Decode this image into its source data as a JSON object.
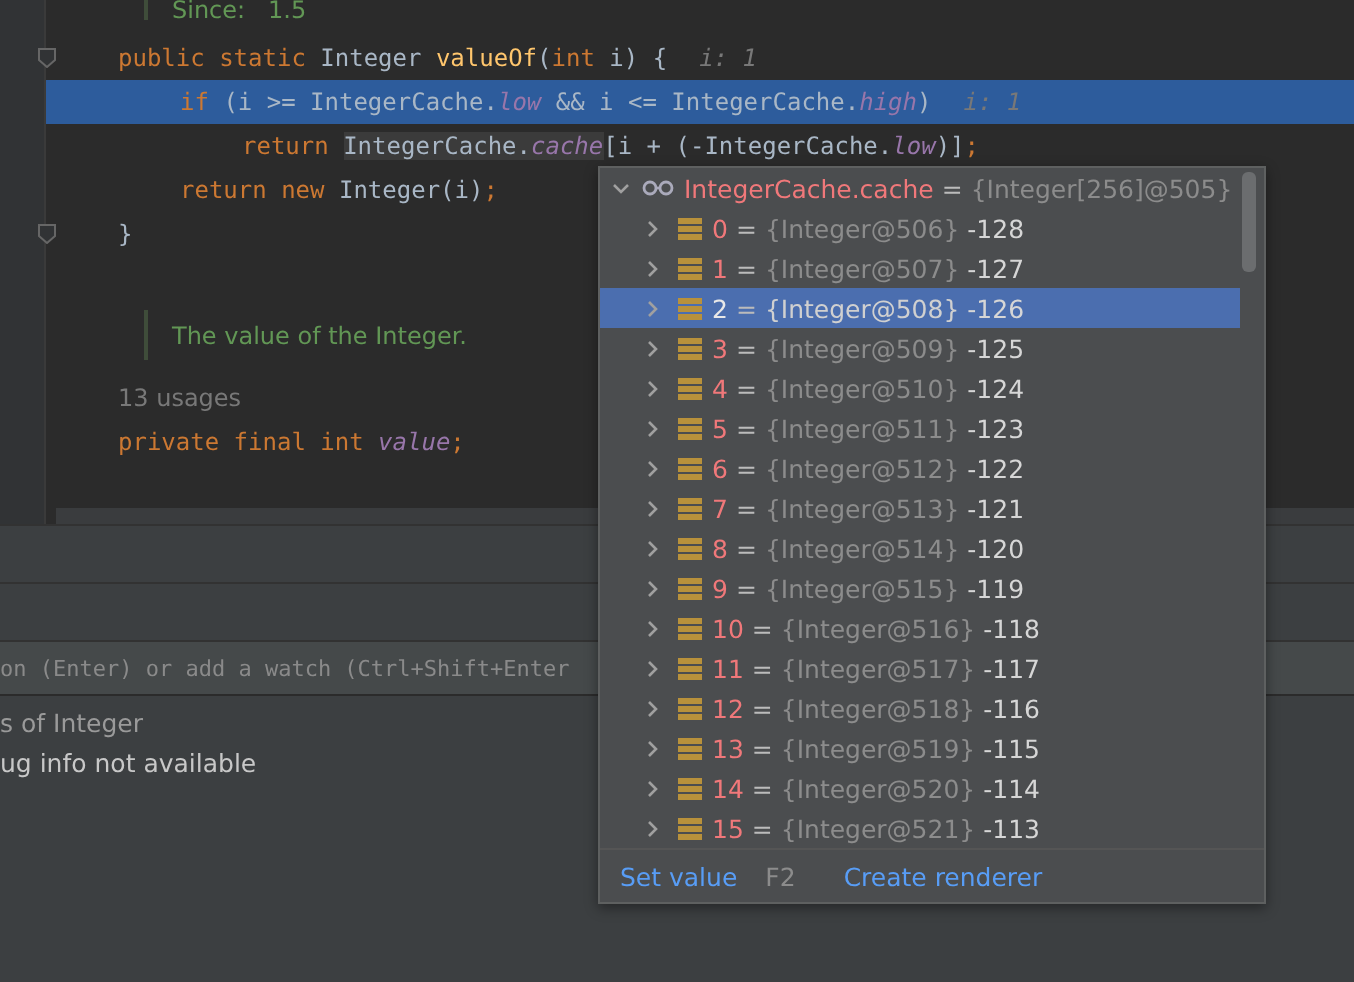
{
  "editor": {
    "lines": [
      {
        "kind": "doc",
        "fold": false,
        "highlighted": false,
        "tokens": [
          {
            "kind": "doc",
            "text": "Since:   1.5"
          }
        ]
      },
      {
        "kind": "code",
        "fold": true,
        "highlighted": false,
        "tokens": [
          {
            "kind": "kw",
            "text": "public static "
          },
          {
            "kind": "plain",
            "text": "Integer "
          },
          {
            "kind": "method",
            "text": "valueOf"
          },
          {
            "kind": "plain",
            "text": "("
          },
          {
            "kind": "kw",
            "text": "int "
          },
          {
            "kind": "plain",
            "text": "i) {"
          },
          {
            "kind": "hint",
            "text": "i: 1"
          }
        ],
        "children": [
          {
            "kind": "code",
            "fold": false,
            "highlighted": true,
            "tokens": [
              {
                "kind": "kw",
                "text": "if "
              },
              {
                "kind": "plain",
                "text": "(i >= IntegerCache."
              },
              {
                "kind": "field",
                "text": "low"
              },
              {
                "kind": "plain",
                "text": " && i <= IntegerCache."
              },
              {
                "kind": "field",
                "text": "high"
              },
              {
                "kind": "plain",
                "text": ")"
              },
              {
                "kind": "hint",
                "text": "i: 1"
              }
            ],
            "children": [
              {
                "kind": "code",
                "fold": false,
                "highlighted": false,
                "tokens": [
                  {
                    "kind": "kw",
                    "text": "return "
                  },
                  {
                    "kind": "ref",
                    "text": "IntegerCache."
                  },
                  {
                    "kind": "reffield",
                    "text": "cache"
                  },
                  {
                    "kind": "plain",
                    "text": "[i + (-IntegerCache."
                  },
                  {
                    "kind": "field",
                    "text": "low"
                  },
                  {
                    "kind": "plain",
                    "text": ")]"
                  },
                  {
                    "kind": "kw",
                    "text": ";"
                  }
                ]
              }
            ]
          },
          {
            "kind": "code",
            "fold": false,
            "highlighted": false,
            "tokens": [
              {
                "kind": "kw",
                "text": "return new "
              },
              {
                "kind": "plain",
                "text": "Integer(i)"
              },
              {
                "kind": "kw",
                "text": ";"
              }
            ]
          }
        ]
      },
      {
        "kind": "code",
        "fold": true,
        "highlighted": false,
        "tokens": [
          {
            "kind": "plain",
            "text": "}"
          }
        ]
      },
      {
        "kind": "doc",
        "fold": false,
        "highlighted": false,
        "tokens": [
          {
            "kind": "doc",
            "text": "The value of the Integer."
          }
        ]
      },
      {
        "kind": "usages",
        "fold": false,
        "highlighted": false,
        "tokens": [
          {
            "kind": "usages",
            "text": "13 usages"
          }
        ]
      },
      {
        "kind": "code",
        "fold": false,
        "highlighted": false,
        "tokens": [
          {
            "kind": "kw",
            "text": "private final int "
          },
          {
            "kind": "field",
            "text": "value"
          },
          {
            "kind": "kw",
            "text": ";"
          }
        ]
      }
    ]
  },
  "debugger": {
    "watch": {
      "placeholder": "on (Enter) or add a watch (Ctrl+Shift+Enter"
    },
    "variables": [
      {
        "text": "s of Integer",
        "dim": true
      },
      {
        "text": "ug info not available",
        "dim": false
      }
    ]
  },
  "popup": {
    "header": {
      "name": "IntegerCache.cache",
      "eq": "=",
      "ref": "{Integer[256]@505}",
      "expanded": true
    },
    "items": [
      {
        "name": "0",
        "eq": "=",
        "ref": "{Integer@506}",
        "value": "-128",
        "selected": false
      },
      {
        "name": "1",
        "eq": "=",
        "ref": "{Integer@507}",
        "value": "-127",
        "selected": false
      },
      {
        "name": "2",
        "eq": "=",
        "ref": "{Integer@508}",
        "value": "-126",
        "selected": true
      },
      {
        "name": "3",
        "eq": "=",
        "ref": "{Integer@509}",
        "value": "-125",
        "selected": false
      },
      {
        "name": "4",
        "eq": "=",
        "ref": "{Integer@510}",
        "value": "-124",
        "selected": false
      },
      {
        "name": "5",
        "eq": "=",
        "ref": "{Integer@511}",
        "value": "-123",
        "selected": false
      },
      {
        "name": "6",
        "eq": "=",
        "ref": "{Integer@512}",
        "value": "-122",
        "selected": false
      },
      {
        "name": "7",
        "eq": "=",
        "ref": "{Integer@513}",
        "value": "-121",
        "selected": false
      },
      {
        "name": "8",
        "eq": "=",
        "ref": "{Integer@514}",
        "value": "-120",
        "selected": false
      },
      {
        "name": "9",
        "eq": "=",
        "ref": "{Integer@515}",
        "value": "-119",
        "selected": false
      },
      {
        "name": "10",
        "eq": "=",
        "ref": "{Integer@516}",
        "value": "-118",
        "selected": false
      },
      {
        "name": "11",
        "eq": "=",
        "ref": "{Integer@517}",
        "value": "-117",
        "selected": false
      },
      {
        "name": "12",
        "eq": "=",
        "ref": "{Integer@518}",
        "value": "-116",
        "selected": false
      },
      {
        "name": "13",
        "eq": "=",
        "ref": "{Integer@519}",
        "value": "-115",
        "selected": false
      },
      {
        "name": "14",
        "eq": "=",
        "ref": "{Integer@520}",
        "value": "-114",
        "selected": false
      },
      {
        "name": "15",
        "eq": "=",
        "ref": "{Integer@521}",
        "value": "-113",
        "selected": false
      }
    ],
    "footer": {
      "set_value": "Set value",
      "shortcut": "F2",
      "create_renderer": "Create renderer"
    }
  }
}
